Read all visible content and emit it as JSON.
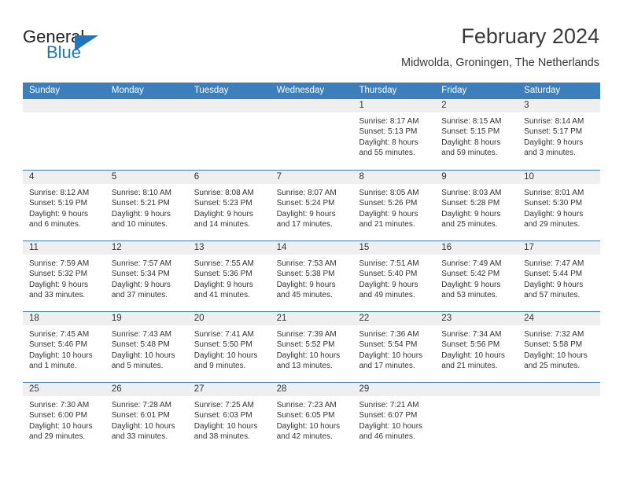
{
  "brand": {
    "name_part1": "General",
    "name_part2": "Blue",
    "accent_color": "#1f76bc"
  },
  "header": {
    "title": "February 2024",
    "subtitle": "Midwolda, Groningen, The Netherlands"
  },
  "calendar": {
    "header_bg": "#3d7ebd",
    "daynum_strip_bg": "#efefef",
    "weekdays": [
      "Sunday",
      "Monday",
      "Tuesday",
      "Wednesday",
      "Thursday",
      "Friday",
      "Saturday"
    ],
    "weeks": [
      [
        {
          "day": ""
        },
        {
          "day": ""
        },
        {
          "day": ""
        },
        {
          "day": ""
        },
        {
          "day": "1",
          "sunrise": "Sunrise: 8:17 AM",
          "sunset": "Sunset: 5:13 PM",
          "daylight": "Daylight: 8 hours and 55 minutes."
        },
        {
          "day": "2",
          "sunrise": "Sunrise: 8:15 AM",
          "sunset": "Sunset: 5:15 PM",
          "daylight": "Daylight: 8 hours and 59 minutes."
        },
        {
          "day": "3",
          "sunrise": "Sunrise: 8:14 AM",
          "sunset": "Sunset: 5:17 PM",
          "daylight": "Daylight: 9 hours and 3 minutes."
        }
      ],
      [
        {
          "day": "4",
          "sunrise": "Sunrise: 8:12 AM",
          "sunset": "Sunset: 5:19 PM",
          "daylight": "Daylight: 9 hours and 6 minutes."
        },
        {
          "day": "5",
          "sunrise": "Sunrise: 8:10 AM",
          "sunset": "Sunset: 5:21 PM",
          "daylight": "Daylight: 9 hours and 10 minutes."
        },
        {
          "day": "6",
          "sunrise": "Sunrise: 8:08 AM",
          "sunset": "Sunset: 5:23 PM",
          "daylight": "Daylight: 9 hours and 14 minutes."
        },
        {
          "day": "7",
          "sunrise": "Sunrise: 8:07 AM",
          "sunset": "Sunset: 5:24 PM",
          "daylight": "Daylight: 9 hours and 17 minutes."
        },
        {
          "day": "8",
          "sunrise": "Sunrise: 8:05 AM",
          "sunset": "Sunset: 5:26 PM",
          "daylight": "Daylight: 9 hours and 21 minutes."
        },
        {
          "day": "9",
          "sunrise": "Sunrise: 8:03 AM",
          "sunset": "Sunset: 5:28 PM",
          "daylight": "Daylight: 9 hours and 25 minutes."
        },
        {
          "day": "10",
          "sunrise": "Sunrise: 8:01 AM",
          "sunset": "Sunset: 5:30 PM",
          "daylight": "Daylight: 9 hours and 29 minutes."
        }
      ],
      [
        {
          "day": "11",
          "sunrise": "Sunrise: 7:59 AM",
          "sunset": "Sunset: 5:32 PM",
          "daylight": "Daylight: 9 hours and 33 minutes."
        },
        {
          "day": "12",
          "sunrise": "Sunrise: 7:57 AM",
          "sunset": "Sunset: 5:34 PM",
          "daylight": "Daylight: 9 hours and 37 minutes."
        },
        {
          "day": "13",
          "sunrise": "Sunrise: 7:55 AM",
          "sunset": "Sunset: 5:36 PM",
          "daylight": "Daylight: 9 hours and 41 minutes."
        },
        {
          "day": "14",
          "sunrise": "Sunrise: 7:53 AM",
          "sunset": "Sunset: 5:38 PM",
          "daylight": "Daylight: 9 hours and 45 minutes."
        },
        {
          "day": "15",
          "sunrise": "Sunrise: 7:51 AM",
          "sunset": "Sunset: 5:40 PM",
          "daylight": "Daylight: 9 hours and 49 minutes."
        },
        {
          "day": "16",
          "sunrise": "Sunrise: 7:49 AM",
          "sunset": "Sunset: 5:42 PM",
          "daylight": "Daylight: 9 hours and 53 minutes."
        },
        {
          "day": "17",
          "sunrise": "Sunrise: 7:47 AM",
          "sunset": "Sunset: 5:44 PM",
          "daylight": "Daylight: 9 hours and 57 minutes."
        }
      ],
      [
        {
          "day": "18",
          "sunrise": "Sunrise: 7:45 AM",
          "sunset": "Sunset: 5:46 PM",
          "daylight": "Daylight: 10 hours and 1 minute."
        },
        {
          "day": "19",
          "sunrise": "Sunrise: 7:43 AM",
          "sunset": "Sunset: 5:48 PM",
          "daylight": "Daylight: 10 hours and 5 minutes."
        },
        {
          "day": "20",
          "sunrise": "Sunrise: 7:41 AM",
          "sunset": "Sunset: 5:50 PM",
          "daylight": "Daylight: 10 hours and 9 minutes."
        },
        {
          "day": "21",
          "sunrise": "Sunrise: 7:39 AM",
          "sunset": "Sunset: 5:52 PM",
          "daylight": "Daylight: 10 hours and 13 minutes."
        },
        {
          "day": "22",
          "sunrise": "Sunrise: 7:36 AM",
          "sunset": "Sunset: 5:54 PM",
          "daylight": "Daylight: 10 hours and 17 minutes."
        },
        {
          "day": "23",
          "sunrise": "Sunrise: 7:34 AM",
          "sunset": "Sunset: 5:56 PM",
          "daylight": "Daylight: 10 hours and 21 minutes."
        },
        {
          "day": "24",
          "sunrise": "Sunrise: 7:32 AM",
          "sunset": "Sunset: 5:58 PM",
          "daylight": "Daylight: 10 hours and 25 minutes."
        }
      ],
      [
        {
          "day": "25",
          "sunrise": "Sunrise: 7:30 AM",
          "sunset": "Sunset: 6:00 PM",
          "daylight": "Daylight: 10 hours and 29 minutes."
        },
        {
          "day": "26",
          "sunrise": "Sunrise: 7:28 AM",
          "sunset": "Sunset: 6:01 PM",
          "daylight": "Daylight: 10 hours and 33 minutes."
        },
        {
          "day": "27",
          "sunrise": "Sunrise: 7:25 AM",
          "sunset": "Sunset: 6:03 PM",
          "daylight": "Daylight: 10 hours and 38 minutes."
        },
        {
          "day": "28",
          "sunrise": "Sunrise: 7:23 AM",
          "sunset": "Sunset: 6:05 PM",
          "daylight": "Daylight: 10 hours and 42 minutes."
        },
        {
          "day": "29",
          "sunrise": "Sunrise: 7:21 AM",
          "sunset": "Sunset: 6:07 PM",
          "daylight": "Daylight: 10 hours and 46 minutes."
        },
        {
          "day": ""
        },
        {
          "day": ""
        }
      ]
    ]
  }
}
